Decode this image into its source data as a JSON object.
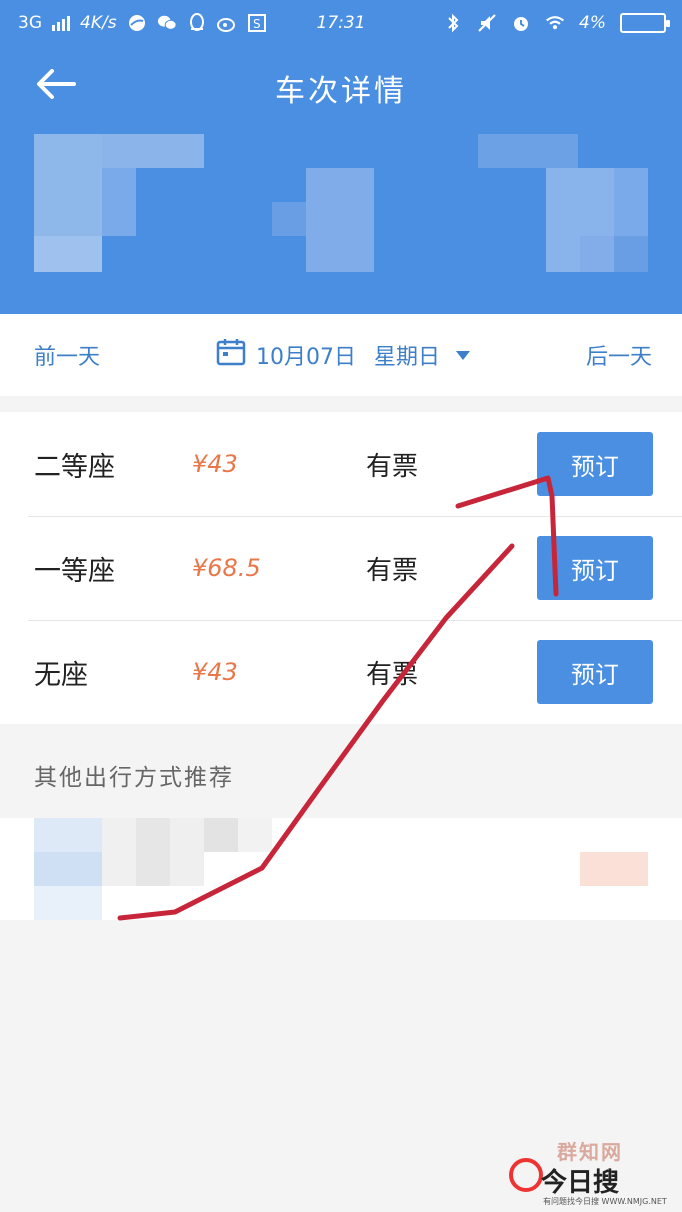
{
  "status_bar": {
    "network": "3G",
    "speed": "4K/s",
    "time": "17:31",
    "battery": "4%"
  },
  "header": {
    "title": "车次详情"
  },
  "date_bar": {
    "prev_label": "前一天",
    "date": "10月07日",
    "weekday": "星期日",
    "next_label": "后一天"
  },
  "seats": [
    {
      "name": "二等座",
      "price": "¥43",
      "availability": "有票",
      "button": "预订"
    },
    {
      "name": "一等座",
      "price": "¥68.5",
      "availability": "有票",
      "button": "预订"
    },
    {
      "name": "无座",
      "price": "¥43",
      "availability": "有票",
      "button": "预订"
    }
  ],
  "other": {
    "title": "其他出行方式推荐"
  },
  "watermark": {
    "top": "群知网",
    "main": "今日搜",
    "sub": "有问题找今日搜 WWW.NMJG.NET"
  },
  "colors": {
    "primary": "#4a8fe1",
    "link": "#3e7fc9",
    "price": "#e8784a",
    "annotation": "#c7263a"
  }
}
